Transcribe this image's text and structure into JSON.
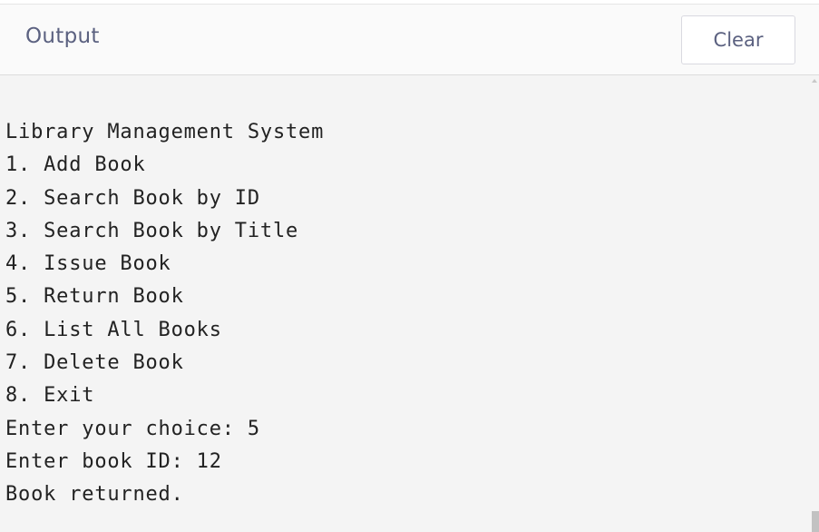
{
  "header": {
    "title": "Output",
    "clear_label": "Clear"
  },
  "output": {
    "lines": [
      "Library Management System",
      "1. Add Book",
      "2. Search Book by ID",
      "3. Search Book by Title",
      "4. Issue Book",
      "5. Return Book",
      "6. List All Books",
      "7. Delete Book",
      "8. Exit",
      "Enter your choice: 5",
      "Enter book ID: 12",
      "Book returned."
    ]
  }
}
